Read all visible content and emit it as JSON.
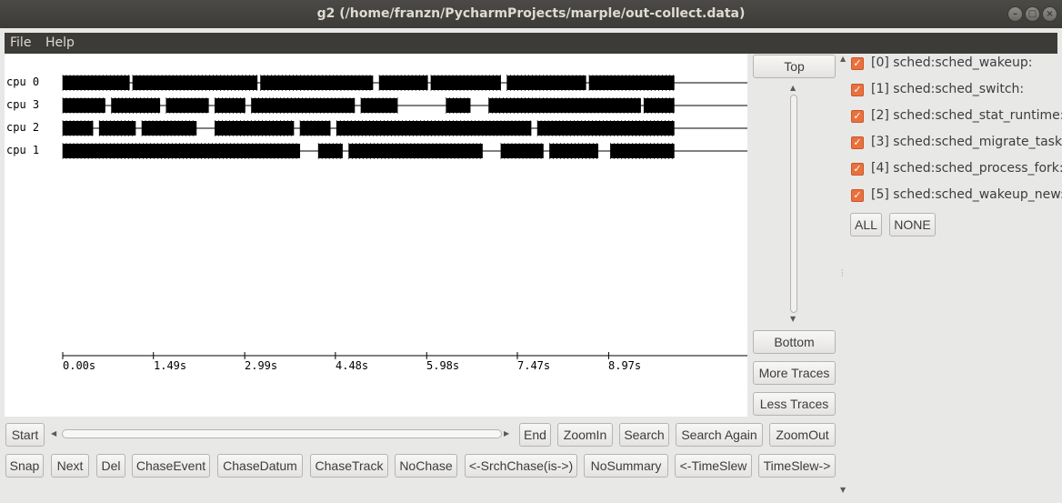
{
  "window": {
    "title": "g2 (/home/franzn/PycharmProjects/marple/out-collect.data)"
  },
  "menu": [
    "File",
    "Help"
  ],
  "cpus": [
    {
      "label": "cpu 0",
      "intervals": [
        [
          0.0,
          1.1
        ],
        [
          1.15,
          3.2
        ],
        [
          3.25,
          5.1
        ],
        [
          5.2,
          6.0
        ],
        [
          6.05,
          7.2
        ],
        [
          7.3,
          8.6
        ],
        [
          8.65,
          10.05
        ]
      ]
    },
    {
      "label": "cpu 3",
      "intervals": [
        [
          0.0,
          0.7
        ],
        [
          0.8,
          1.6
        ],
        [
          1.7,
          2.4
        ],
        [
          2.5,
          3.0
        ],
        [
          3.1,
          4.8
        ],
        [
          4.9,
          5.5
        ],
        [
          6.3,
          6.7
        ],
        [
          7.0,
          9.5
        ],
        [
          9.55,
          10.05
        ]
      ]
    },
    {
      "label": "cpu 2",
      "intervals": [
        [
          0.0,
          0.5
        ],
        [
          0.6,
          1.2
        ],
        [
          1.3,
          2.2
        ],
        [
          2.5,
          3.8
        ],
        [
          3.9,
          4.4
        ],
        [
          4.5,
          7.7
        ],
        [
          7.8,
          10.05
        ]
      ]
    },
    {
      "label": "cpu 1",
      "intervals": [
        [
          0.0,
          3.9
        ],
        [
          4.2,
          4.6
        ],
        [
          4.7,
          6.9
        ],
        [
          7.2,
          7.9
        ],
        [
          8.0,
          8.8
        ],
        [
          9.0,
          10.05
        ]
      ]
    }
  ],
  "axis": {
    "ticks": [
      {
        "value": 0.0,
        "label": "0.00s"
      },
      {
        "value": 1.49,
        "label": "1.49s"
      },
      {
        "value": 2.99,
        "label": "2.99s"
      },
      {
        "value": 4.48,
        "label": "4.48s"
      },
      {
        "value": 5.98,
        "label": "5.98s"
      },
      {
        "value": 7.47,
        "label": "7.47s"
      },
      {
        "value": 8.97,
        "label": "8.97s"
      }
    ]
  },
  "side_buttons": {
    "top": "Top",
    "bottom": "Bottom",
    "more_traces": "More Traces",
    "less_traces": "Less Traces"
  },
  "toolbar_row1": {
    "start": "Start",
    "end": "End",
    "zoom_in": "ZoomIn",
    "search": "Search",
    "search_again": "Search Again",
    "zoom_out": "ZoomOut"
  },
  "toolbar_row2": {
    "snap": "Snap",
    "next": "Next",
    "del": "Del",
    "chase_event": "ChaseEvent",
    "chase_datum": "ChaseDatum",
    "chase_track": "ChaseTrack",
    "no_chase": "NoChase",
    "srch_chase": "<-SrchChase(is->)",
    "no_summary": "NoSummary",
    "time_slew_back": "<-TimeSlew",
    "time_slew_fwd": "TimeSlew->"
  },
  "event_filters": [
    {
      "label": "[0] sched:sched_wakeup:",
      "checked": true
    },
    {
      "label": "[1] sched:sched_switch:",
      "checked": true
    },
    {
      "label": "[2] sched:sched_stat_runtime:",
      "checked": true
    },
    {
      "label": "[3] sched:sched_migrate_task:",
      "checked": true
    },
    {
      "label": "[4] sched:sched_process_fork:",
      "checked": true
    },
    {
      "label": "[5] sched:sched_wakeup_new:",
      "checked": true
    }
  ],
  "filter_buttons": {
    "all": "ALL",
    "none": "NONE"
  },
  "colors": {
    "accent_checkbox": "#e9713d",
    "titlebar": "#3c3b37"
  }
}
